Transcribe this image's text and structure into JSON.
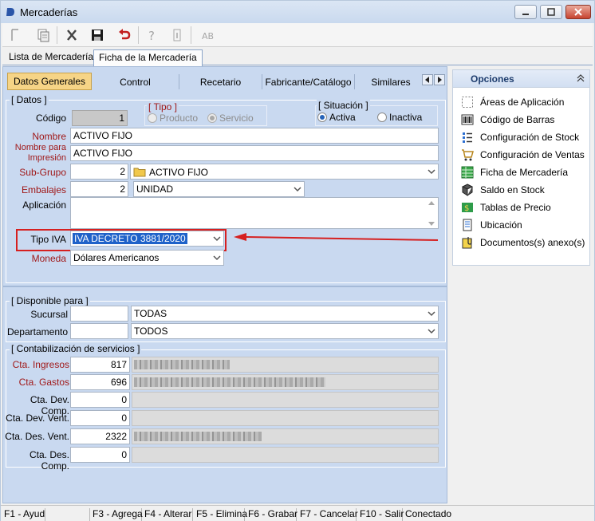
{
  "window": {
    "title": "Mercaderías"
  },
  "outer_tabs": [
    {
      "label": "Lista de Mercaderías"
    },
    {
      "label": "Ficha de la Mercadería"
    }
  ],
  "inner_tabs": [
    {
      "label": "Datos Generales"
    },
    {
      "label": "Control"
    },
    {
      "label": "Recetario"
    },
    {
      "label": "Fabricante/Catálogo"
    },
    {
      "label": "Similares"
    }
  ],
  "datos": {
    "group_title": "[ Datos ]",
    "codigo_label": "Código",
    "codigo_value": "1",
    "tipo_title": "[ Tipo ]",
    "tipo_options": [
      "Producto",
      "Servicio"
    ],
    "situacion_title": "[ Situación ]",
    "situacion_options": [
      "Activa",
      "Inactiva"
    ],
    "nombre_label": "Nombre",
    "nombre_value": "ACTIVO FIJO",
    "nombre_impresion_label_1": "Nombre para",
    "nombre_impresion_label_2": "Impresión",
    "nombre_impresion_value": "ACTIVO FIJO",
    "subgrupo_label": "Sub-Grupo",
    "subgrupo_code": "2",
    "subgrupo_value": "ACTIVO FIJO",
    "embalajes_label": "Embalajes",
    "embalajes_code": "2",
    "embalajes_value": "UNIDAD",
    "aplicacion_label": "Aplicación",
    "tipo_iva_label": "Tipo IVA",
    "tipo_iva_value": "IVA DECRETO 3881/2020",
    "moneda_label": "Moneda",
    "moneda_value": "Dólares Americanos"
  },
  "disponible": {
    "group_title": "[ Disponible para ]",
    "sucursal_label": "Sucursal",
    "sucursal_value": "TODAS",
    "departamento_label": "Departamento",
    "departamento_value": "TODOS"
  },
  "contabilizacion": {
    "group_title": "[ Contabilización de servicios ]",
    "rows": [
      {
        "label": "Cta. Ingresos",
        "value": "817",
        "red": true
      },
      {
        "label": "Cta. Gastos",
        "value": "696",
        "red": true
      },
      {
        "label": "Cta. Dev. Comp.",
        "value": "0",
        "red": false
      },
      {
        "label": "Cta. Dev. Vent.",
        "value": "0",
        "red": false
      },
      {
        "label": "Cta. Des. Vent.",
        "value": "2322",
        "red": false
      },
      {
        "label": "Cta. Des. Comp.",
        "value": "0",
        "red": false
      }
    ]
  },
  "sidebar": {
    "title": "Opciones",
    "items": [
      {
        "label": "Áreas de Aplicación",
        "icon": "dashed-square-icon"
      },
      {
        "label": "Código de Barras",
        "icon": "barcode-icon"
      },
      {
        "label": "Configuración de Stock",
        "icon": "stock-list-icon"
      },
      {
        "label": "Configuración de Ventas",
        "icon": "cart-icon"
      },
      {
        "label": "Ficha de Mercadería",
        "icon": "sheet-icon"
      },
      {
        "label": "Saldo en Stock",
        "icon": "boxes-icon"
      },
      {
        "label": "Tablas de Precio",
        "icon": "price-table-icon"
      },
      {
        "label": "Ubicación",
        "icon": "location-icon"
      },
      {
        "label": "Documentos(s) anexo(s)",
        "icon": "attachment-icon"
      }
    ]
  },
  "statusbar": [
    "F1 - Ayud",
    "F3 - Agrega",
    "F4 - Alterar",
    "F5 - Elimina",
    "F6 - Grabar",
    "F7 - Cancelar",
    "F10 - Salir",
    "Conectado"
  ],
  "colors": {
    "highlight_red": "#d62020",
    "panel_blue": "#c9d9f0",
    "active_tab": "#f6d486",
    "label_red": "#a01818"
  }
}
